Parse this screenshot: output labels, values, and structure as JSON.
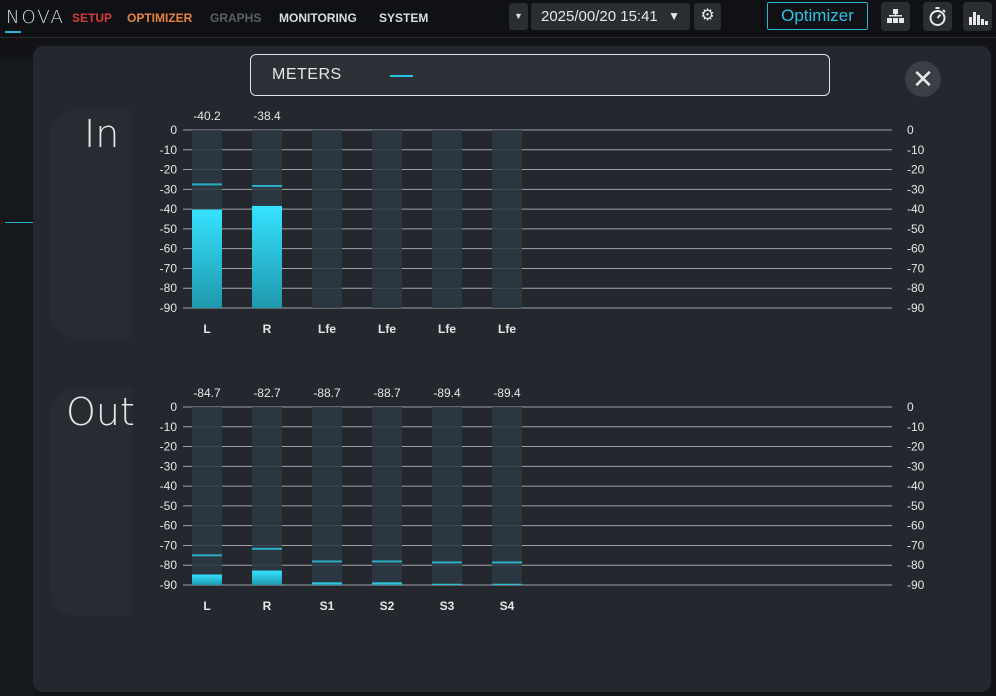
{
  "topbar": {
    "logo": "NOVA",
    "nav": {
      "setup": "SETUP",
      "optimizer": "OPTIMIZER",
      "graphs": "GRAPHS",
      "monitoring": "MONITORING",
      "system": "SYSTEM"
    },
    "datetime": "2025/00/20 15:41",
    "optimizer_button": "Optimizer",
    "icons": [
      "caret-down-icon",
      "settings-gear-icon",
      "network-tree-icon",
      "stopwatch-icon",
      "meters-bars-icon"
    ]
  },
  "modal": {
    "tab_label": "METERS",
    "close_icon": "close-icon"
  },
  "colors": {
    "accent": "#29c3df",
    "setup": "#d63b3b",
    "optimizer": "#e8843a",
    "graphs_disabled": "#5c6066"
  },
  "meters": {
    "scale_ticks": [
      "0",
      "-10",
      "-20",
      "-30",
      "-40",
      "-50",
      "-60",
      "-70",
      "-80",
      "-90"
    ],
    "scale_min": -90,
    "scale_max": 0,
    "in": {
      "title": "In",
      "channels": [
        {
          "label": "L",
          "readout": "-40.2",
          "level": -40.2,
          "peak": -27.5
        },
        {
          "label": "R",
          "readout": "-38.4",
          "level": -38.4,
          "peak": -28.3
        },
        {
          "label": "Lfe",
          "readout": "",
          "level": null,
          "peak": null
        },
        {
          "label": "Lfe",
          "readout": "",
          "level": null,
          "peak": null
        },
        {
          "label": "Lfe",
          "readout": "",
          "level": null,
          "peak": null
        },
        {
          "label": "Lfe",
          "readout": "",
          "level": null,
          "peak": null
        }
      ]
    },
    "out": {
      "title": "Out",
      "channels": [
        {
          "label": "L",
          "readout": "-84.7",
          "level": -84.7,
          "peak": -75.0
        },
        {
          "label": "R",
          "readout": "-82.7",
          "level": -82.7,
          "peak": -71.7
        },
        {
          "label": "S1",
          "readout": "-88.7",
          "level": -88.7,
          "peak": -78.1
        },
        {
          "label": "S2",
          "readout": "-88.7",
          "level": -88.7,
          "peak": -78.1
        },
        {
          "label": "S3",
          "readout": "-89.4",
          "level": -89.4,
          "peak": -78.6
        },
        {
          "label": "S4",
          "readout": "-89.4",
          "level": -89.4,
          "peak": -78.6
        }
      ]
    }
  }
}
